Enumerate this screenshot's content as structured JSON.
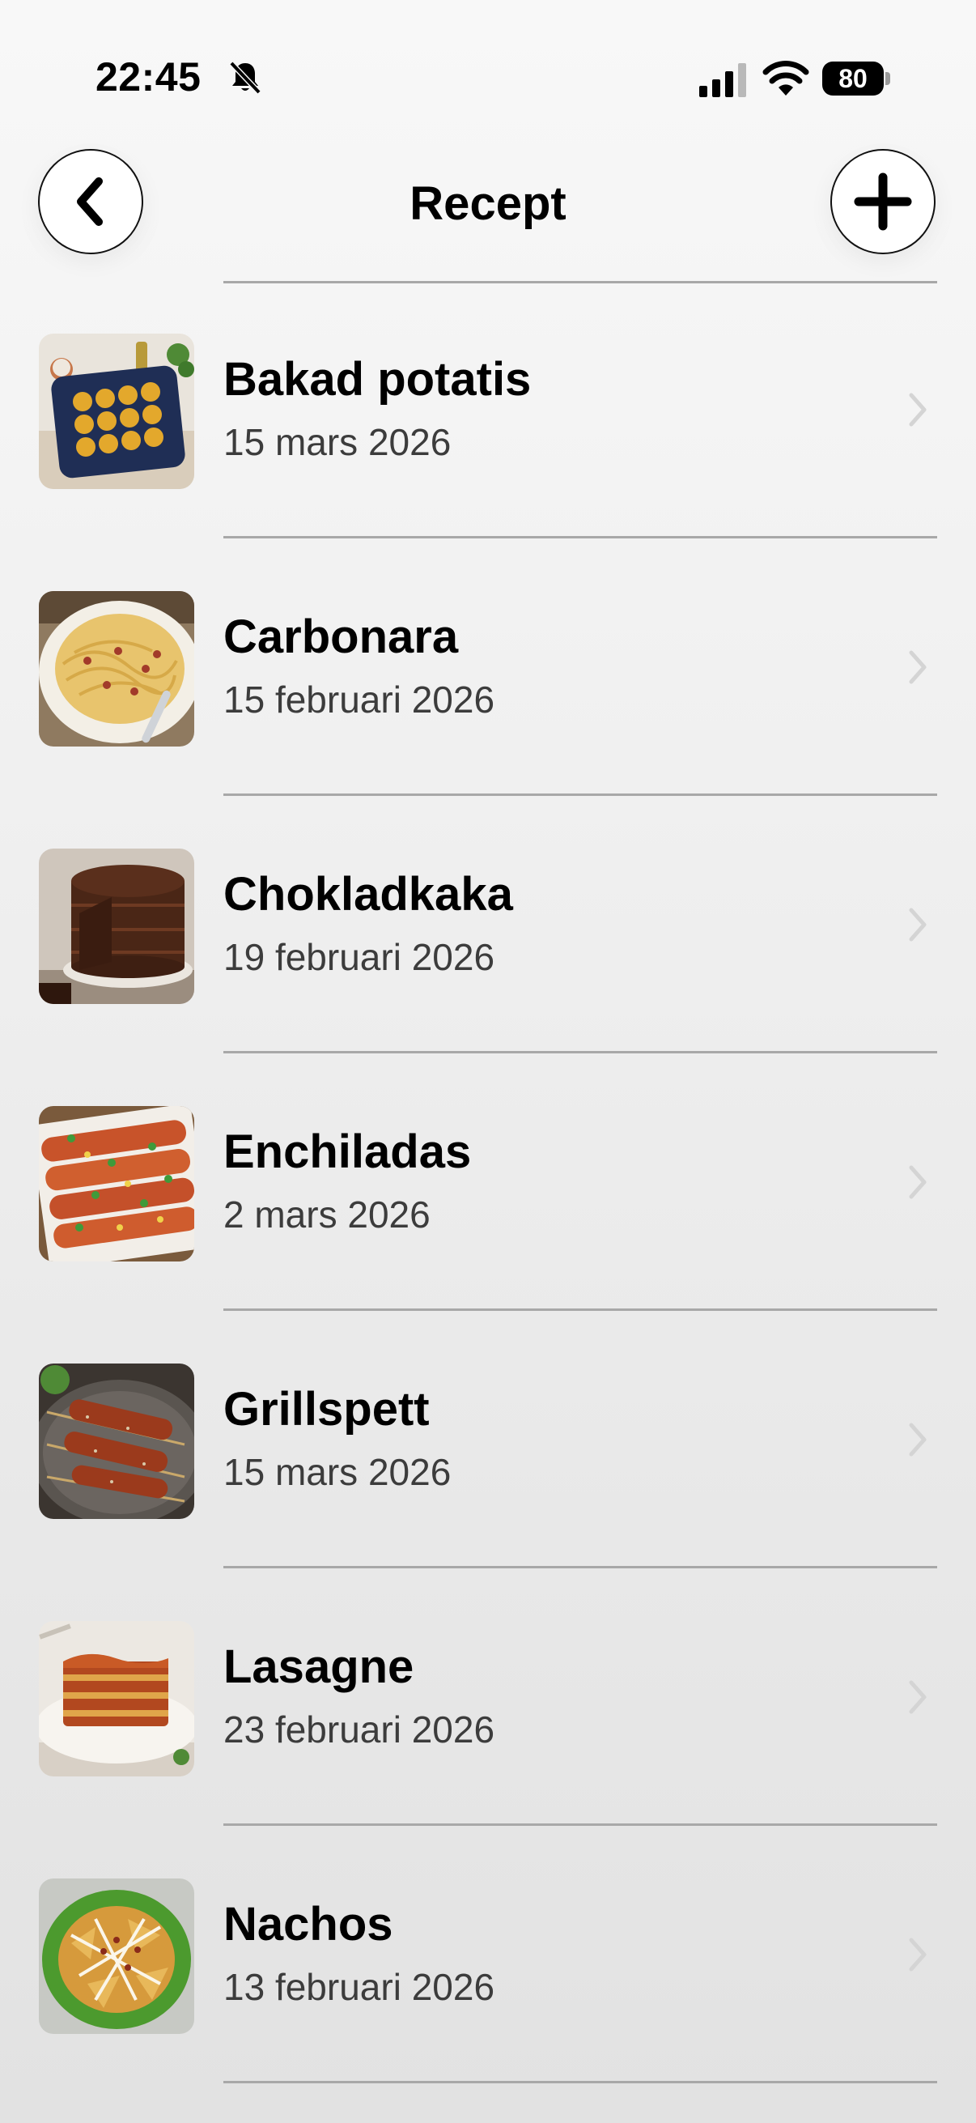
{
  "status": {
    "time": "22:45",
    "battery": "80"
  },
  "nav": {
    "title": "Recept"
  },
  "icons": {
    "back": "chevron-left-icon",
    "add": "plus-icon",
    "bell": "bell-slash-icon",
    "signal": "cellular-signal-icon",
    "wifi": "wifi-icon",
    "battery": "battery-icon",
    "row_chevron": "chevron-right-icon"
  },
  "recipes": [
    {
      "name": "Bakad potatis",
      "date": "15 mars 2026"
    },
    {
      "name": "Carbonara",
      "date": "15 februari 2026"
    },
    {
      "name": "Chokladkaka",
      "date": "19 februari 2026"
    },
    {
      "name": "Enchiladas",
      "date": "2 mars 2026"
    },
    {
      "name": "Grillspett",
      "date": "15 mars 2026"
    },
    {
      "name": "Lasagne",
      "date": "23 februari 2026"
    },
    {
      "name": "Nachos",
      "date": "13 februari 2026"
    }
  ]
}
